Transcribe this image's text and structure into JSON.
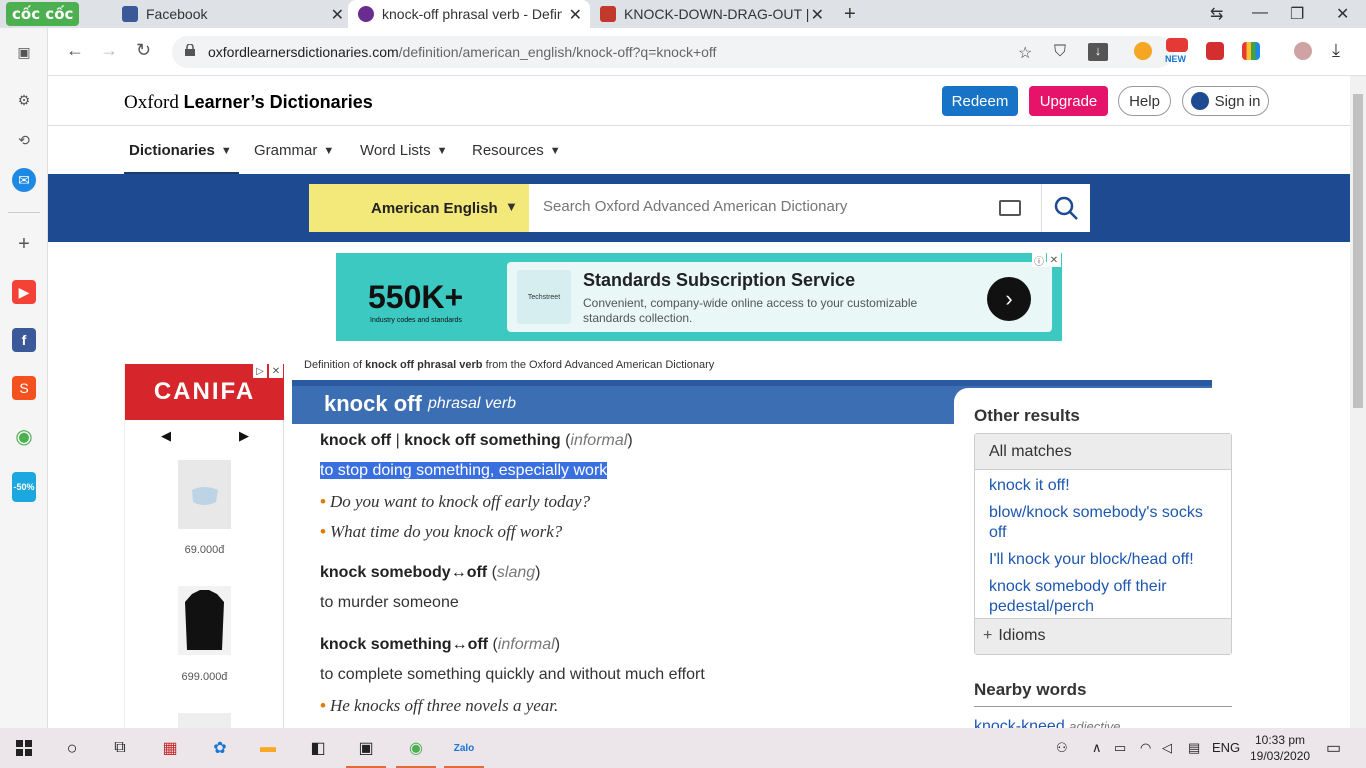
{
  "browser": {
    "brand": "cốc cốc",
    "tabs": [
      {
        "title": "Facebook"
      },
      {
        "title": "knock-off phrasal verb - Defin"
      },
      {
        "title": "KNOCK-DOWN-DRAG-OUT |"
      }
    ],
    "new_tab_label": "+",
    "url_domain": "oxfordlearnersdictionaries.com",
    "url_path": "/definition/american_english/knock-off?q=knock+off",
    "new_badge": "NEW"
  },
  "site": {
    "brand_prefix": "Oxford",
    "brand_bold": "Learner’s Dictionaries",
    "redeem": "Redeem",
    "upgrade": "Upgrade",
    "help": "Help",
    "sign_in": "Sign in",
    "menu": [
      "Dictionaries",
      "Grammar",
      "Word Lists",
      "Resources"
    ],
    "search": {
      "language": "American English",
      "placeholder": "Search Oxford Advanced American Dictionary"
    }
  },
  "ad_banner": {
    "big_number": "550K+",
    "sub": "Industry codes and standards",
    "logo": "Techstreet",
    "title": "Standards Subscription Service",
    "desc": "Convenient, company-wide online access to your customizable standards collection."
  },
  "side_ad": {
    "brand": "CANIFA",
    "prev": "◀",
    "next": "▶",
    "prices": [
      "69.000đ",
      "699.000đ"
    ]
  },
  "entry": {
    "caption_pre": "Definition of ",
    "caption_bold": "knock off phrasal verb",
    "caption_post": " from the Oxford Advanced American Dictionary",
    "headword": "knock off",
    "pos": "phrasal verb",
    "senses": [
      {
        "forms_a": "knock off",
        "sep": " | ",
        "forms_b": "knock off something",
        "label": "informal",
        "definition": "to stop doing something, especially work",
        "examples": [
          "Do you want to knock off early today?",
          "What time do you knock off work?"
        ]
      },
      {
        "forms_a": "knock somebody↔off",
        "label": "slang",
        "definition": "to murder someone",
        "examples": []
      },
      {
        "forms_a": "knock something↔off",
        "label": "informal",
        "definition": "to complete something quickly and without much effort",
        "examples": [
          "He knocks off three novels a year."
        ]
      }
    ]
  },
  "other_results": {
    "heading": "Other results",
    "all_matches": "All matches",
    "matches": [
      "knock it off!",
      "blow/knock somebody's socks off",
      "I'll knock your block/head off!",
      "knock somebody off their pedestal/perch"
    ],
    "idioms": "Idioms",
    "nearby_heading": "Nearby words",
    "nearby_first": "knock-kneed",
    "nearby_first_pos": "adjective"
  },
  "taskbar": {
    "lang": "ENG",
    "time": "10:33 pm",
    "date": "19/03/2020"
  }
}
